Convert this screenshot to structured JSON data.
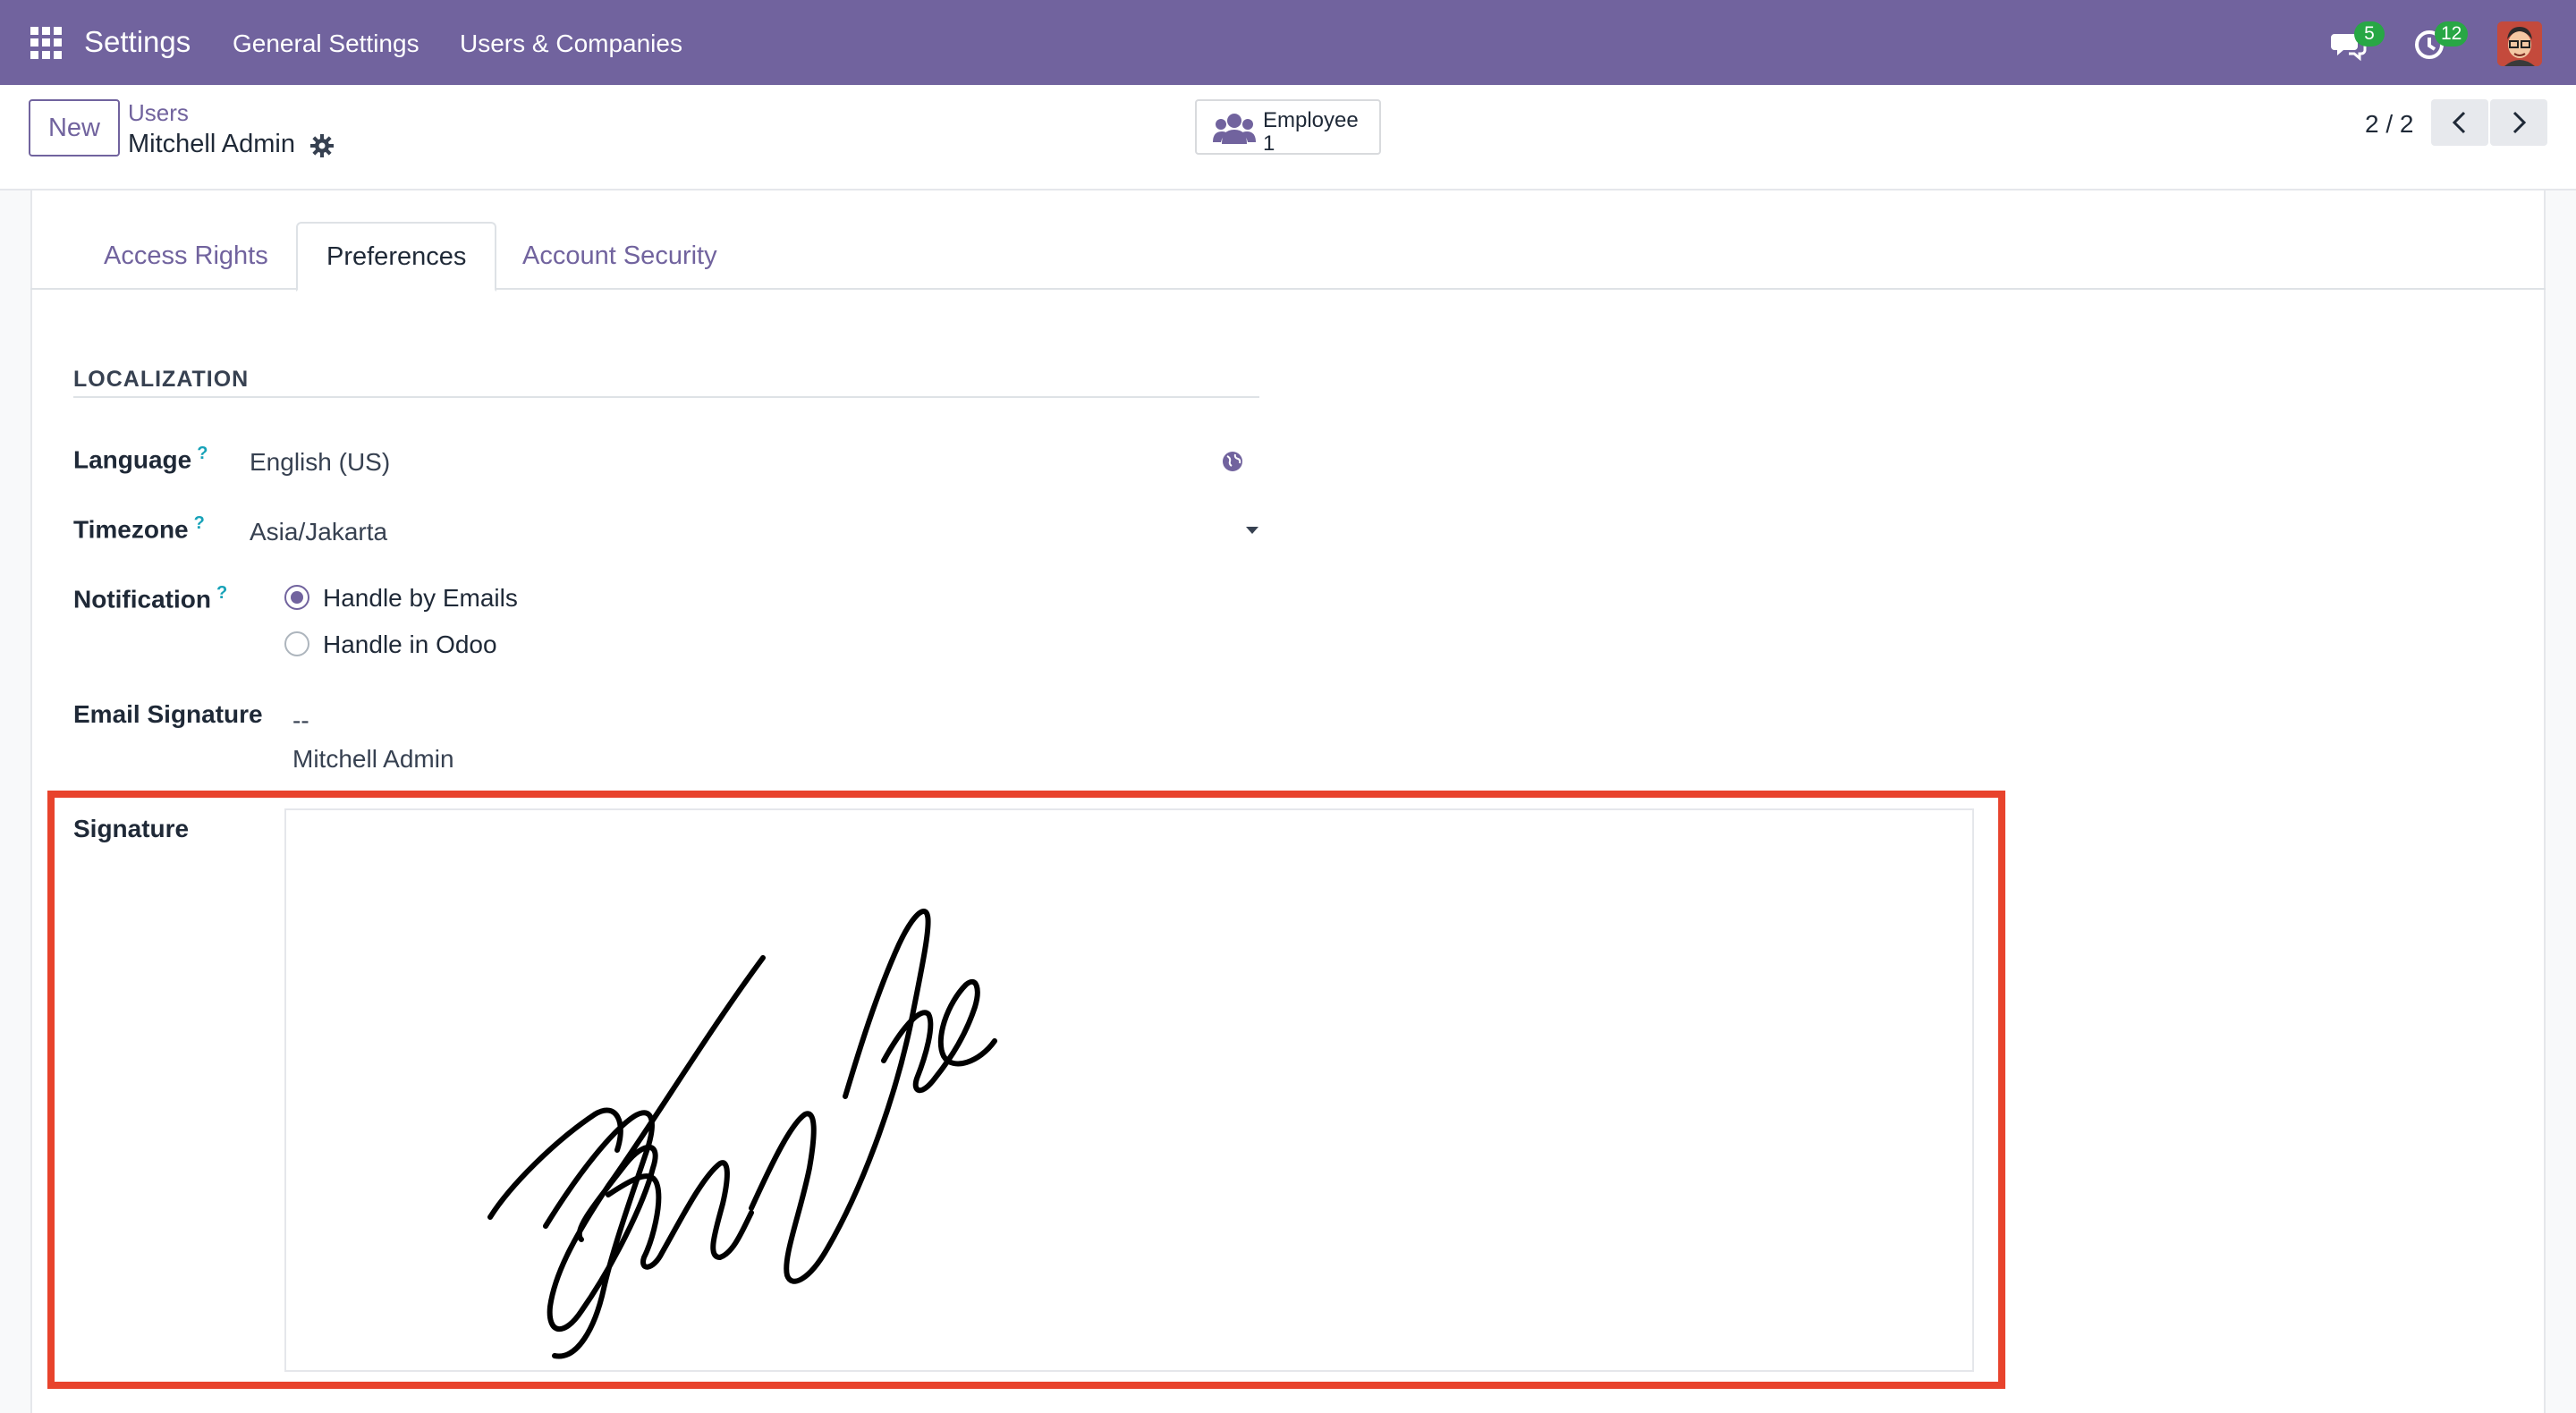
{
  "navbar": {
    "app_name": "Settings",
    "menu": [
      "General Settings",
      "Users & Companies"
    ],
    "messages_count": "5",
    "activities_count": "12",
    "accent_color": "#71639e"
  },
  "control_panel": {
    "new_label": "New",
    "breadcrumb_parent": "Users",
    "breadcrumb_current": "Mitchell Admin",
    "smart_button": {
      "label": "Employee",
      "value": "1"
    },
    "pager": "2 / 2"
  },
  "tabs": [
    "Access Rights",
    "Preferences",
    "Account Security"
  ],
  "active_tab": "Preferences",
  "localization": {
    "title": "LOCALIZATION",
    "language_label": "Language",
    "language_value": "English (US)",
    "timezone_label": "Timezone",
    "timezone_value": "Asia/Jakarta",
    "notification_label": "Notification",
    "notification_options": [
      "Handle by Emails",
      "Handle in Odoo"
    ],
    "notification_selected": "Handle by Emails",
    "help_mark": "?",
    "email_signature_label": "Email Signature",
    "email_signature_lines": [
      "--",
      "Mitchell Admin"
    ],
    "signature_label": "Signature",
    "highlight_color": "#e8432c"
  }
}
